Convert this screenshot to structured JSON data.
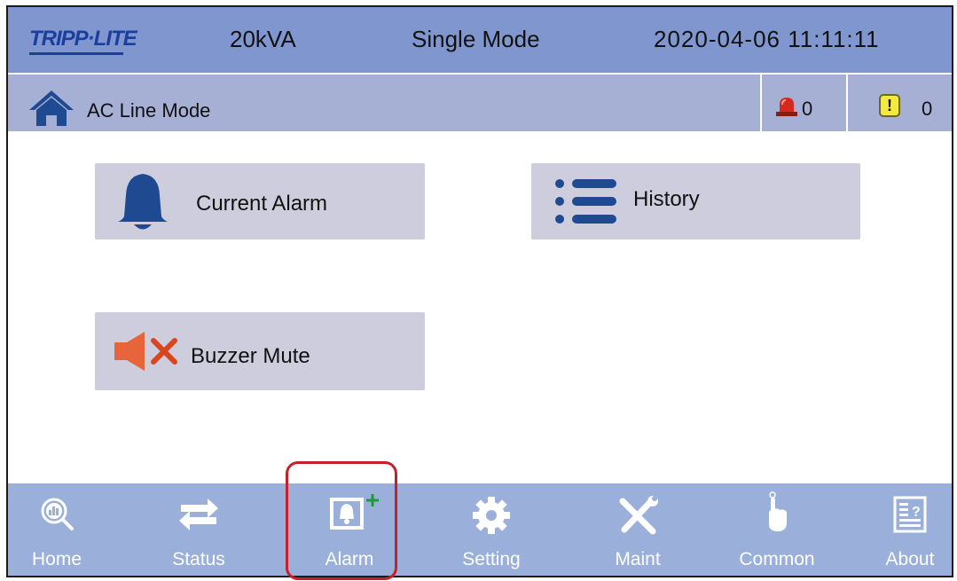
{
  "header": {
    "logo_text": "TRIPP·LITE",
    "capacity": "20kVA",
    "mode": "Single Mode",
    "datetime": "2020-04-06 11:11:11"
  },
  "status_bar": {
    "mode_text": "AC Line Mode",
    "alarm_count": "0",
    "warning_symbol": "!",
    "warning_count": "0"
  },
  "menu": {
    "current_alarm_label": "Current Alarm",
    "history_label": "History",
    "buzzer_mute_label": "Buzzer Mute"
  },
  "nav": {
    "items": [
      {
        "label": "Home",
        "icon": "home-magnifier-icon"
      },
      {
        "label": "Status",
        "icon": "status-arrows-icon"
      },
      {
        "label": "Alarm",
        "icon": "alarm-bell-icon"
      },
      {
        "label": "Setting",
        "icon": "gear-icon"
      },
      {
        "label": "Maint",
        "icon": "wrench-screwdriver-icon"
      },
      {
        "label": "Common",
        "icon": "pointing-hand-icon"
      },
      {
        "label": "About",
        "icon": "about-document-icon"
      }
    ],
    "selected": "Alarm"
  },
  "colors": {
    "header_bg": "#7f97ce",
    "status_bg": "#a6b0d5",
    "nav_bg": "#9bafdb",
    "button_bg": "#cecddd",
    "icon_blue": "#1f4a91",
    "highlight_red": "#c8202a",
    "mute_orange": "#e8643a"
  }
}
